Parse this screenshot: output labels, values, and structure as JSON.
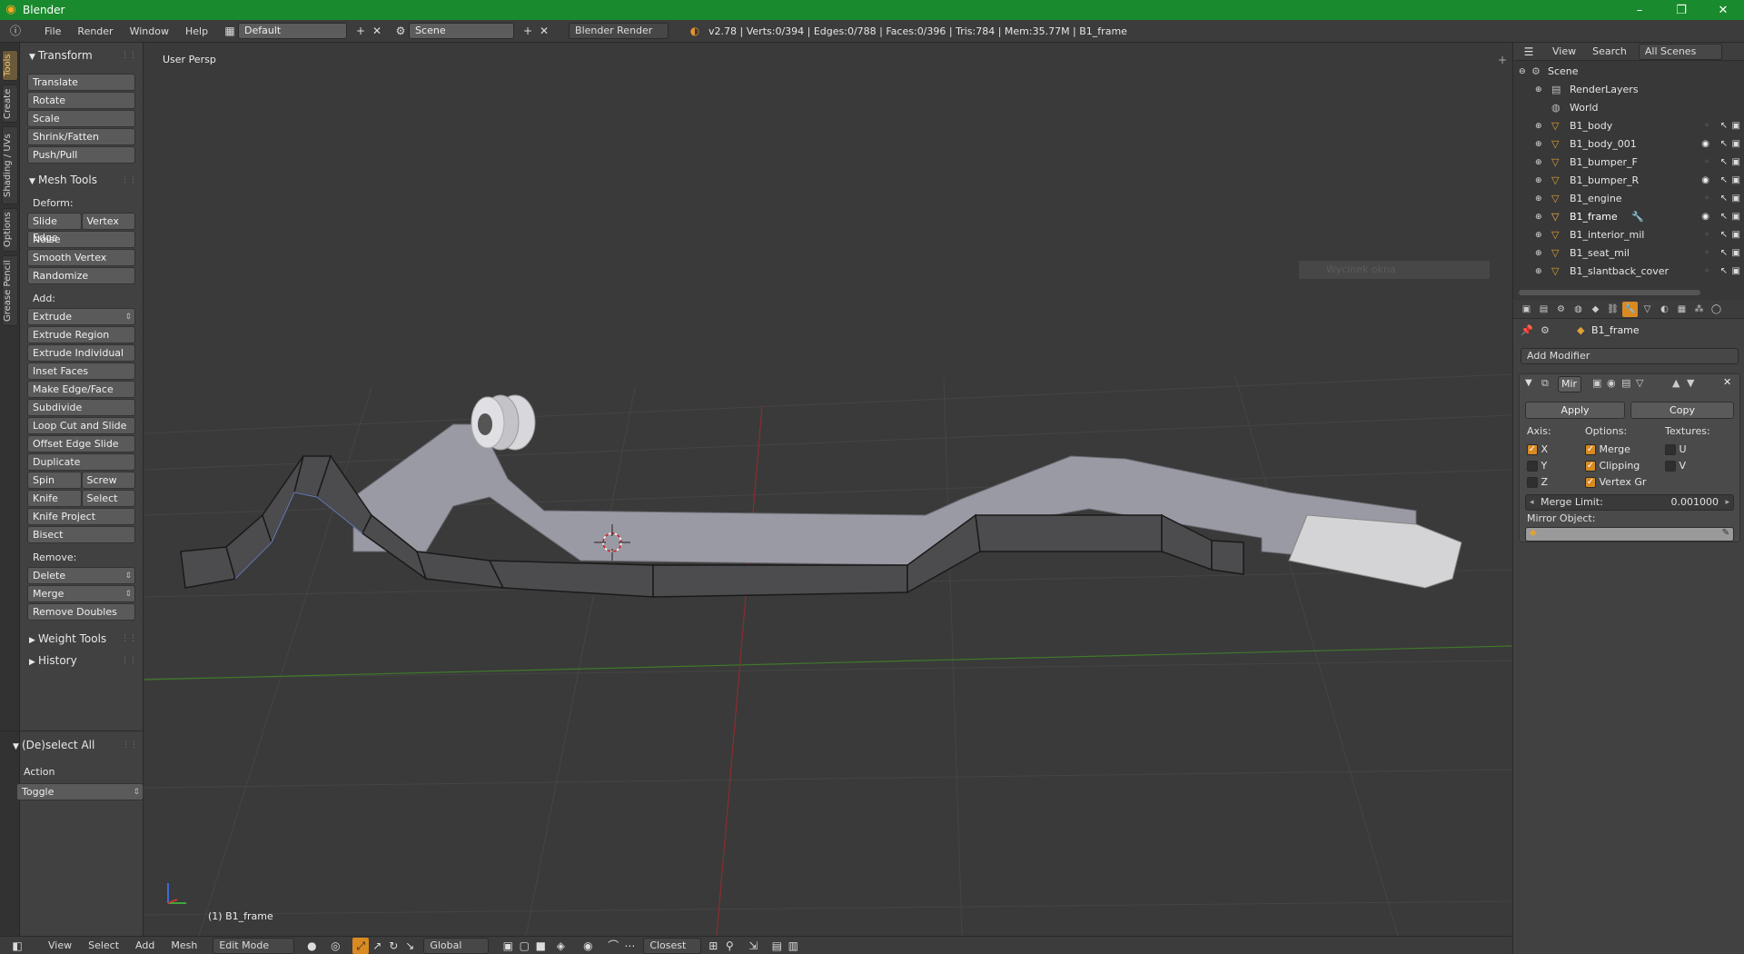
{
  "window": {
    "title": "Blender",
    "minimize": "–",
    "maximize": "❐",
    "close": "✕"
  },
  "info_header": {
    "menus": [
      "File",
      "Render",
      "Window",
      "Help"
    ],
    "layout": "Default",
    "scene": "Scene",
    "engine": "Blender Render",
    "stats": "v2.78 | Verts:0/394 | Edges:0/788 | Faces:0/396 | Tris:784 | Mem:35.77M | B1_frame"
  },
  "tool_tabs": [
    "Tools",
    "Create",
    "Shading / UVs",
    "Options",
    "Grease Pencil"
  ],
  "toolshelf": {
    "transform": {
      "title": "Transform",
      "items": [
        "Translate",
        "Rotate",
        "Scale",
        "Shrink/Fatten",
        "Push/Pull"
      ]
    },
    "mesh_tools": {
      "title": "Mesh Tools",
      "deform_label": "Deform:",
      "slide_edge": "Slide Edge",
      "vertex": "Vertex",
      "deform_items": [
        "Noise",
        "Smooth Vertex",
        "Randomize"
      ],
      "add_label": "Add:",
      "extrude": "Extrude",
      "add_items": [
        "Extrude Region",
        "Extrude Individual",
        "Inset Faces",
        "Make Edge/Face",
        "Subdivide",
        "Loop Cut and Slide",
        "Offset Edge Slide",
        "Duplicate"
      ],
      "spin": "Spin",
      "screw": "Screw",
      "knife": "Knife",
      "select": "Select",
      "knife_project": "Knife Project",
      "bisect": "Bisect",
      "remove_label": "Remove:",
      "delete": "Delete",
      "merge": "Merge",
      "remove_doubles": "Remove Doubles"
    },
    "weight_tools": "Weight Tools",
    "history": "History",
    "operator": {
      "title": "(De)select All",
      "action_label": "Action",
      "action_value": "Toggle"
    }
  },
  "viewport": {
    "label": "User Persp",
    "object": "(1) B1_frame",
    "tooltip": "Wycinek okna"
  },
  "bottom_header": {
    "menus": [
      "View",
      "Select",
      "Add",
      "Mesh"
    ],
    "mode": "Edit Mode",
    "orientation": "Global",
    "snap": "Closest"
  },
  "outliner": {
    "tabs": [
      "View",
      "Search",
      "All Scenes"
    ],
    "scene": "Scene",
    "items": [
      {
        "name": "RenderLayers",
        "visible": null
      },
      {
        "name": "World",
        "visible": null
      },
      {
        "name": "B1_body",
        "visible": false
      },
      {
        "name": "B1_body_001",
        "visible": true
      },
      {
        "name": "B1_bumper_F",
        "visible": false
      },
      {
        "name": "B1_bumper_R",
        "visible": true
      },
      {
        "name": "B1_engine",
        "visible": false
      },
      {
        "name": "B1_frame",
        "visible": true
      },
      {
        "name": "B1_interior_mil",
        "visible": false
      },
      {
        "name": "B1_seat_mil",
        "visible": false
      },
      {
        "name": "B1_slantback_cover",
        "visible": false
      }
    ]
  },
  "properties": {
    "object": "B1_frame",
    "add_modifier": "Add Modifier",
    "modifier_name": "Mir",
    "apply": "Apply",
    "copy": "Copy",
    "axis_label": "Axis:",
    "options_label": "Options:",
    "textures_label": "Textures:",
    "axis": [
      {
        "name": "X",
        "on": true
      },
      {
        "name": "Y",
        "on": false
      },
      {
        "name": "Z",
        "on": false
      }
    ],
    "options": [
      {
        "name": "Merge",
        "on": true
      },
      {
        "name": "Clipping",
        "on": true
      },
      {
        "name": "Vertex Gr",
        "on": true
      }
    ],
    "textures": [
      {
        "name": "U",
        "on": false
      },
      {
        "name": "V",
        "on": false
      }
    ],
    "merge_limit_label": "Merge Limit:",
    "merge_limit_value": "0.001000",
    "mirror_object_label": "Mirror Object:"
  },
  "colors": {
    "accent": "#d98a21",
    "title_green": "#1a8a2e"
  }
}
